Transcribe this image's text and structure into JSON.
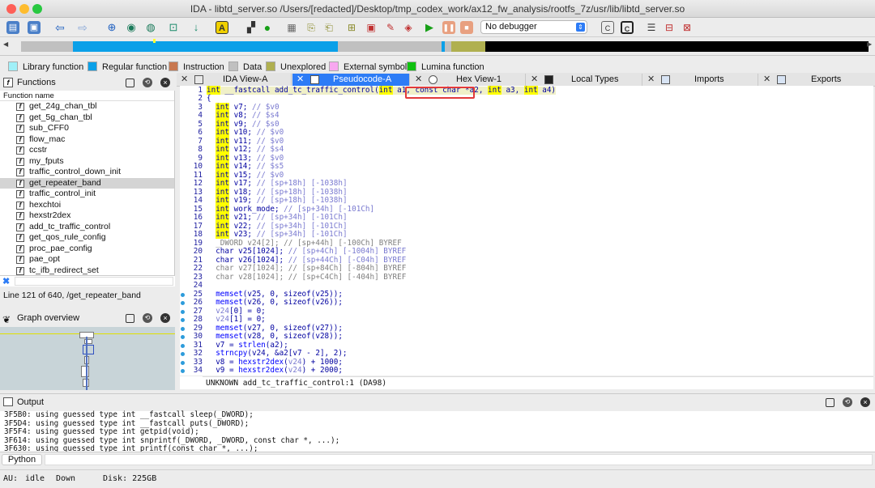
{
  "window": {
    "title": "IDA - libtd_server.so /Users/[redacted]/Desktop/tmp_codex_work/ax12_fw_analysis/rootfs_7z/usr/lib/libtd_server.so"
  },
  "toolbar": {
    "debugger_select": "No debugger"
  },
  "legend": [
    {
      "label": "Library function",
      "color": "#a0f0f8"
    },
    {
      "label": "Regular function",
      "color": "#0aa0e8"
    },
    {
      "label": "Instruction",
      "color": "#c87850"
    },
    {
      "label": "Data",
      "color": "#c0c0c0"
    },
    {
      "label": "Unexplored",
      "color": "#b0b050"
    },
    {
      "label": "External symbol",
      "color": "#f8a8f0"
    },
    {
      "label": "Lumina function",
      "color": "#10c010"
    }
  ],
  "functions": {
    "title": "Functions",
    "column": "Function name",
    "items": [
      "get_24g_chan_tbl",
      "get_5g_chan_tbl",
      "sub_CFF0",
      "flow_mac",
      "ccstr",
      "my_fputs",
      "traffic_control_down_init",
      "get_repeater_band",
      "traffic_control_init",
      "hexchtoi",
      "hexstr2dex",
      "add_tc_traffic_control",
      "get_qos_rule_config",
      "proc_pae_config",
      "pae_opt",
      "tc_ifb_redirect_set"
    ],
    "selected_index": 7,
    "status": "Line 121 of 640, /get_repeater_band"
  },
  "graph_overview": {
    "title": "Graph overview"
  },
  "tabs": [
    {
      "label": "IDA View-A",
      "active": false
    },
    {
      "label": "Pseudocode-A",
      "active": true
    },
    {
      "label": "Hex View-1",
      "active": false
    },
    {
      "label": "Local Types",
      "active": false
    },
    {
      "label": "Imports",
      "active": false
    },
    {
      "label": "Exports",
      "active": false
    }
  ],
  "code_lines": [
    {
      "n": "1",
      "bp": false,
      "html": "<span class=\"kw\">int</span> __fastcall add_tc_traffic_control(<span class=\"kw\">int</span> a1, const char *a2, <span class=\"kw\">int</span> a3, <span class=\"kw\">int</span> a4)"
    },
    {
      "n": "2",
      "bp": false,
      "html": "{"
    },
    {
      "n": "3",
      "bp": false,
      "html": "  <span class=\"kw\">int</span> v7; <span class=\"cm\">// $v0</span>"
    },
    {
      "n": "4",
      "bp": false,
      "html": "  <span class=\"kw\">int</span> v8; <span class=\"cm\">// $s4</span>"
    },
    {
      "n": "5",
      "bp": false,
      "html": "  <span class=\"kw\">int</span> v9; <span class=\"cm\">// $s0</span>"
    },
    {
      "n": "6",
      "bp": false,
      "html": "  <span class=\"kw\">int</span> v10; <span class=\"cm\">// $v0</span>"
    },
    {
      "n": "7",
      "bp": false,
      "html": "  <span class=\"kw\">int</span> v11; <span class=\"cm\">// $v0</span>"
    },
    {
      "n": "8",
      "bp": false,
      "html": "  <span class=\"kw\">int</span> v12; <span class=\"cm\">// $s4</span>"
    },
    {
      "n": "9",
      "bp": false,
      "html": "  <span class=\"kw\">int</span> v13; <span class=\"cm\">// $v0</span>"
    },
    {
      "n": "10",
      "bp": false,
      "html": "  <span class=\"kw\">int</span> v14; <span class=\"cm\">// $s5</span>"
    },
    {
      "n": "11",
      "bp": false,
      "html": "  <span class=\"kw\">int</span> v15; <span class=\"cm\">// $v0</span>"
    },
    {
      "n": "12",
      "bp": false,
      "html": "  <span class=\"kw\">int</span> v17; <span class=\"cm\">// [sp+18h] [-1038h]</span>"
    },
    {
      "n": "13",
      "bp": false,
      "html": "  <span class=\"kw\">int</span> v18; <span class=\"cm\">// [sp+18h] [-1038h]</span>"
    },
    {
      "n": "14",
      "bp": false,
      "html": "  <span class=\"kw\">int</span> v19; <span class=\"cm\">// [sp+18h] [-1038h]</span>"
    },
    {
      "n": "15",
      "bp": false,
      "html": "  <span class=\"kw\">int</span> work_mode; <span class=\"cm\">// [sp+34h] [-101Ch]</span>"
    },
    {
      "n": "16",
      "bp": false,
      "html": "  <span class=\"kw\">int</span> v21; <span class=\"cm\">// [sp+34h] [-101Ch]</span>"
    },
    {
      "n": "17",
      "bp": false,
      "html": "  <span class=\"kw\">int</span> v22; <span class=\"cm\">// [sp+34h] [-101Ch]</span>"
    },
    {
      "n": "18",
      "bp": false,
      "html": "  <span class=\"kw\">int</span> v23; <span class=\"cm\">// [sp+34h] [-101Ch]</span>"
    },
    {
      "n": "19",
      "bp": false,
      "html": "  <span class=\"gr\">_DWORD v24[2]; // [sp+44h] [-100Ch] BYREF</span>"
    },
    {
      "n": "20",
      "bp": false,
      "html": "  char v25[1024]; <span class=\"cm\">// [sp+4Ch] [-1004h] BYREF</span>"
    },
    {
      "n": "21",
      "bp": false,
      "html": "  char v26[1024]; <span class=\"cm\">// [sp+44Ch] [-C04h] BYREF</span>"
    },
    {
      "n": "22",
      "bp": false,
      "html": "  <span class=\"gr\">char v27[1024]; // [sp+84Ch] [-804h] BYREF</span>"
    },
    {
      "n": "23",
      "bp": false,
      "html": "  <span class=\"gr\">char v28[1024]; // [sp+C4Ch] [-404h] BYREF</span>"
    },
    {
      "n": "24",
      "bp": false,
      "html": ""
    },
    {
      "n": "25",
      "bp": true,
      "html": "  <span class=\"fn\">memset</span>(v25, 0, sizeof(v25));"
    },
    {
      "n": "26",
      "bp": true,
      "html": "  <span class=\"fn\">memset</span>(v26, 0, sizeof(v26));"
    },
    {
      "n": "27",
      "bp": true,
      "html": "  <span class=\"cm\">v24</span>[0] = 0;"
    },
    {
      "n": "28",
      "bp": true,
      "html": "  <span class=\"cm\">v24</span>[1] = 0;"
    },
    {
      "n": "29",
      "bp": true,
      "html": "  <span class=\"fn\">memset</span>(v27, 0, sizeof(v27));"
    },
    {
      "n": "30",
      "bp": true,
      "html": "  <span class=\"fn\">memset</span>(v28, 0, sizeof(v28));"
    },
    {
      "n": "31",
      "bp": true,
      "html": "  v7 = <span class=\"fn\">strlen</span>(a2);"
    },
    {
      "n": "32",
      "bp": true,
      "html": "  <span class=\"fn\">strncpy</span>(v24, &amp;a2[v7 - 2], 2);"
    },
    {
      "n": "33",
      "bp": true,
      "html": "  v8 = <span class=\"fn\">hexstr2dex</span>(<span class=\"cm\">v24</span>) + 1000;"
    },
    {
      "n": "34",
      "bp": true,
      "html": "  v9 = <span class=\"fn\">hexstr2dex</span>(<span class=\"cm\">v24</span>) + 2000;"
    }
  ],
  "code_status": "UNKNOWN add_tc_traffic_control:1 (DA98)",
  "output": {
    "title": "Output",
    "lines": [
      "3F5B0: using guessed type int __fastcall sleep(_DWORD);",
      "3F5D4: using guessed type int __fastcall puts(_DWORD);",
      "3F5F4: using guessed type int getpid(void);",
      "3F614: using guessed type int snprintf(_DWORD, _DWORD, const char *, ...);",
      "3F630: using guessed type int printf(const char *, ...);"
    ],
    "tab": "Python"
  },
  "statusbar": {
    "au": "AU:",
    "state": "idle",
    "dir": "Down",
    "disk": "Disk: 225GB"
  }
}
